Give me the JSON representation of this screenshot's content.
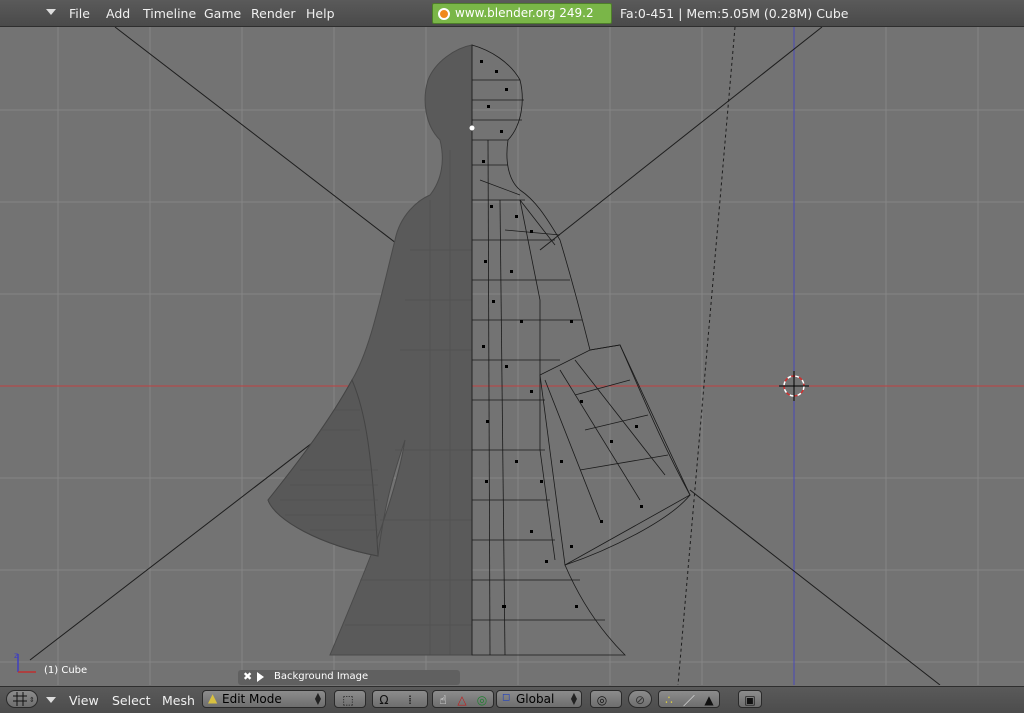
{
  "menubar": {
    "items": [
      "File",
      "Add",
      "Timeline",
      "Game",
      "Render",
      "Help"
    ],
    "site_tag": "www.blender.org 249.2",
    "stats": "Fa:0-451 | Mem:5.05M (0.28M) Cube"
  },
  "viewport": {
    "object_label": "(1) Cube",
    "panel_label": "Background Image"
  },
  "header": {
    "view_label": "View",
    "select_label": "Select",
    "mesh_label": "Mesh",
    "mode_value": "Edit Mode",
    "orientation_value": "Global"
  },
  "icons": {
    "window_type": "grid-icon",
    "pivot": "cube-pivot-icon",
    "magnet": "magnet-icon",
    "manipulator_hand": "hand-icon",
    "manipulator_translate": "translate-icon",
    "manipulator_rotate": "rotate-icon",
    "orientation": "global-icon",
    "proportional": "proportional-icon",
    "vertex_select": "vertex-select-icon",
    "edge_select": "edge-select-icon",
    "face_select": "face-select-icon",
    "render_preview": "render-icon"
  },
  "colors": {
    "viewport_bg": "#737373",
    "site_tag": "#7ab648",
    "x_axis": "#c04040",
    "y_axis": "#4a4ab8"
  }
}
